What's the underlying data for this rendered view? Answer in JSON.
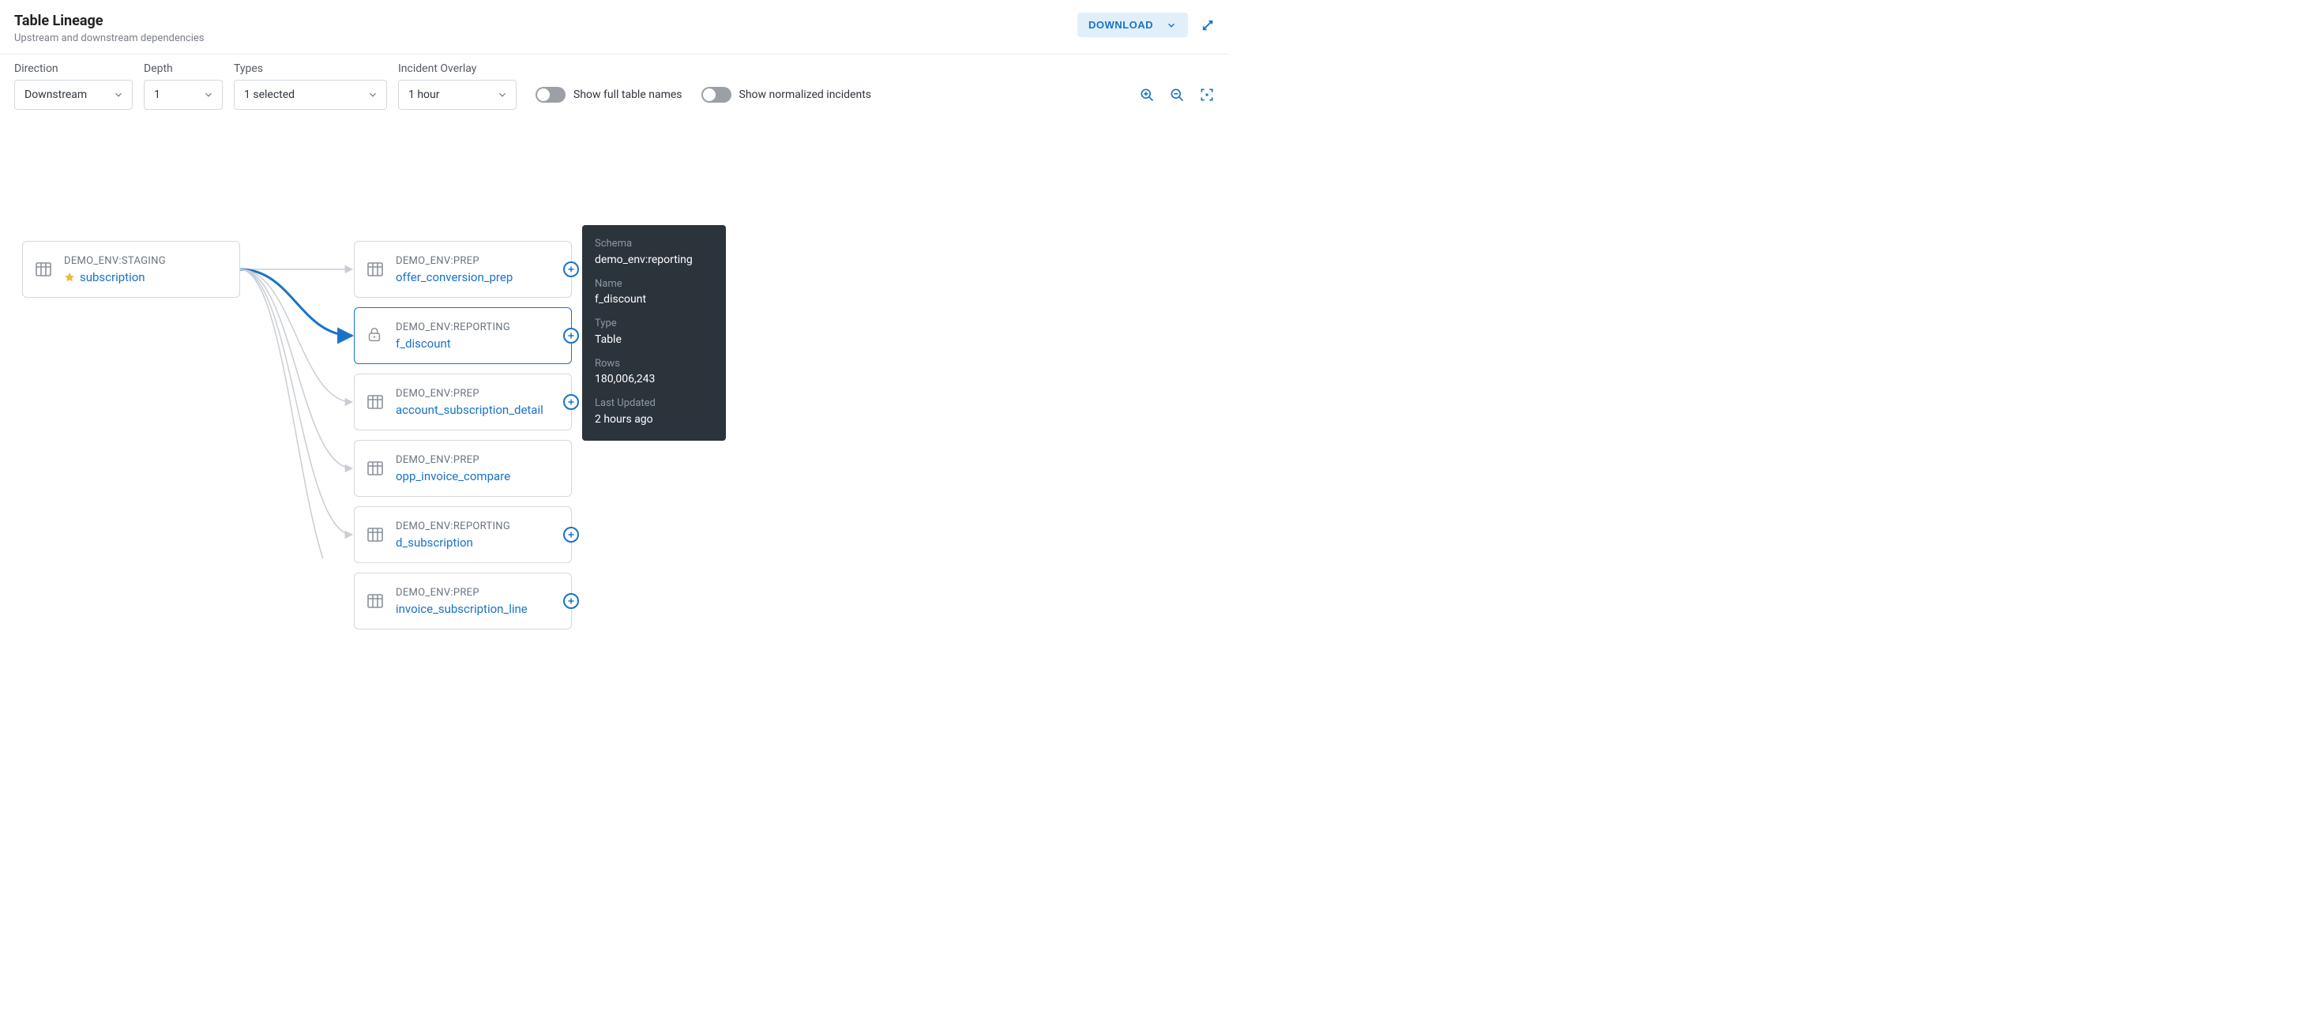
{
  "header": {
    "title": "Table Lineage",
    "subtitle": "Upstream and downstream dependencies",
    "download_label": "DOWNLOAD"
  },
  "filters": {
    "direction": {
      "label": "Direction",
      "value": "Downstream"
    },
    "depth": {
      "label": "Depth",
      "value": "1"
    },
    "types": {
      "label": "Types",
      "value": "1 selected"
    },
    "incident_overlay": {
      "label": "Incident Overlay",
      "value": "1 hour"
    }
  },
  "toggles": {
    "full_names": {
      "label": "Show full table names",
      "on": false
    },
    "normalized_incidents": {
      "label": "Show normalized incidents",
      "on": false
    }
  },
  "root_node": {
    "namespace": "DEMO_ENV:STAGING",
    "name": "subscription",
    "starred": true
  },
  "nodes": [
    {
      "namespace": "DEMO_ENV:PREP",
      "name": "offer_conversion_prep",
      "expandable": true,
      "icon": "table"
    },
    {
      "namespace": "DEMO_ENV:REPORTING",
      "name": "f_discount",
      "expandable": true,
      "icon": "lock",
      "selected": true
    },
    {
      "namespace": "DEMO_ENV:PREP",
      "name": "account_subscription_detail",
      "expandable": true,
      "icon": "table"
    },
    {
      "namespace": "DEMO_ENV:PREP",
      "name": "opp_invoice_compare",
      "expandable": false,
      "icon": "table"
    },
    {
      "namespace": "DEMO_ENV:REPORTING",
      "name": "d_subscription",
      "expandable": true,
      "icon": "table"
    },
    {
      "namespace": "DEMO_ENV:PREP",
      "name": "invoice_subscription_line",
      "expandable": true,
      "icon": "table"
    }
  ],
  "tooltip": {
    "schema_label": "Schema",
    "schema_value": "demo_env:reporting",
    "name_label": "Name",
    "name_value": "f_discount",
    "type_label": "Type",
    "type_value": "Table",
    "rows_label": "Rows",
    "rows_value": "180,006,243",
    "updated_label": "Last Updated",
    "updated_value": "2 hours ago"
  }
}
